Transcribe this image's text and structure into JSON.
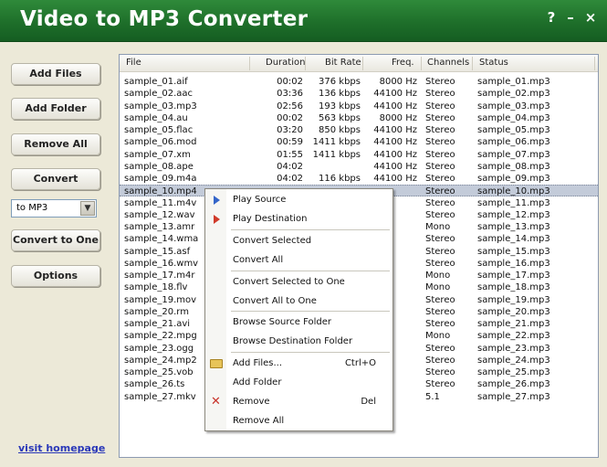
{
  "window": {
    "title": "Video to MP3 Converter",
    "help_glyph": "?",
    "minimize_glyph": "–",
    "close_glyph": "×"
  },
  "left_panel": {
    "add_files": "Add Files",
    "add_folder": "Add Folder",
    "remove_all": "Remove All",
    "convert": "Convert",
    "format_selected": "to MP3",
    "convert_to_one": "Convert to One",
    "options": "Options",
    "homepage_link": "visit homepage"
  },
  "table": {
    "headers": {
      "file": "File",
      "duration": "Duration",
      "bitrate": "Bit Rate",
      "freq": "Freq.",
      "channels": "Channels",
      "status": "Status"
    },
    "selected_index": 9,
    "rows": [
      {
        "file": "sample_01.aif",
        "duration": "00:02",
        "bitrate": "376 kbps",
        "freq": "8000 Hz",
        "channels": "Stereo",
        "status": "sample_01.mp3"
      },
      {
        "file": "sample_02.aac",
        "duration": "03:36",
        "bitrate": "136 kbps",
        "freq": "44100 Hz",
        "channels": "Stereo",
        "status": "sample_02.mp3"
      },
      {
        "file": "sample_03.mp3",
        "duration": "02:56",
        "bitrate": "193 kbps",
        "freq": "44100 Hz",
        "channels": "Stereo",
        "status": "sample_03.mp3"
      },
      {
        "file": "sample_04.au",
        "duration": "00:02",
        "bitrate": "563 kbps",
        "freq": "8000 Hz",
        "channels": "Stereo",
        "status": "sample_04.mp3"
      },
      {
        "file": "sample_05.flac",
        "duration": "03:20",
        "bitrate": "850 kbps",
        "freq": "44100 Hz",
        "channels": "Stereo",
        "status": "sample_05.mp3"
      },
      {
        "file": "sample_06.mod",
        "duration": "00:59",
        "bitrate": "1411 kbps",
        "freq": "44100 Hz",
        "channels": "Stereo",
        "status": "sample_06.mp3"
      },
      {
        "file": "sample_07.xm",
        "duration": "01:55",
        "bitrate": "1411 kbps",
        "freq": "44100 Hz",
        "channels": "Stereo",
        "status": "sample_07.mp3"
      },
      {
        "file": "sample_08.ape",
        "duration": "04:02",
        "bitrate": "",
        "freq": "44100 Hz",
        "channels": "Stereo",
        "status": "sample_08.mp3"
      },
      {
        "file": "sample_09.m4a",
        "duration": "04:02",
        "bitrate": "116 kbps",
        "freq": "44100 Hz",
        "channels": "Stereo",
        "status": "sample_09.mp3"
      },
      {
        "file": "sample_10.mp4",
        "duration": "",
        "bitrate": "",
        "freq": "",
        "channels": "Stereo",
        "status": "sample_10.mp3"
      },
      {
        "file": "sample_11.m4v",
        "duration": "",
        "bitrate": "",
        "freq": "",
        "channels": "Stereo",
        "status": "sample_11.mp3"
      },
      {
        "file": "sample_12.wav",
        "duration": "",
        "bitrate": "",
        "freq": "",
        "channels": "Stereo",
        "status": "sample_12.mp3"
      },
      {
        "file": "sample_13.amr",
        "duration": "",
        "bitrate": "",
        "freq": "",
        "channels": "Mono",
        "status": "sample_13.mp3"
      },
      {
        "file": "sample_14.wma",
        "duration": "",
        "bitrate": "",
        "freq": "",
        "channels": "Stereo",
        "status": "sample_14.mp3"
      },
      {
        "file": "sample_15.asf",
        "duration": "",
        "bitrate": "",
        "freq": "",
        "channels": "Stereo",
        "status": "sample_15.mp3"
      },
      {
        "file": "sample_16.wmv",
        "duration": "",
        "bitrate": "",
        "freq": "",
        "channels": "Stereo",
        "status": "sample_16.mp3"
      },
      {
        "file": "sample_17.m4r",
        "duration": "",
        "bitrate": "",
        "freq": "",
        "channels": "Mono",
        "status": "sample_17.mp3"
      },
      {
        "file": "sample_18.flv",
        "duration": "",
        "bitrate": "",
        "freq": "",
        "channels": "Mono",
        "status": "sample_18.mp3"
      },
      {
        "file": "sample_19.mov",
        "duration": "",
        "bitrate": "",
        "freq": "",
        "channels": "Stereo",
        "status": "sample_19.mp3"
      },
      {
        "file": "sample_20.rm",
        "duration": "",
        "bitrate": "",
        "freq": "",
        "channels": "Stereo",
        "status": "sample_20.mp3"
      },
      {
        "file": "sample_21.avi",
        "duration": "",
        "bitrate": "",
        "freq": "",
        "channels": "Stereo",
        "status": "sample_21.mp3"
      },
      {
        "file": "sample_22.mpg",
        "duration": "",
        "bitrate": "",
        "freq": "",
        "channels": "Mono",
        "status": "sample_22.mp3"
      },
      {
        "file": "sample_23.ogg",
        "duration": "",
        "bitrate": "",
        "freq": "",
        "channels": "Stereo",
        "status": "sample_23.mp3"
      },
      {
        "file": "sample_24.mp2",
        "duration": "",
        "bitrate": "",
        "freq": "",
        "channels": "Stereo",
        "status": "sample_24.mp3"
      },
      {
        "file": "sample_25.vob",
        "duration": "",
        "bitrate": "",
        "freq": "",
        "channels": "Stereo",
        "status": "sample_25.mp3"
      },
      {
        "file": "sample_26.ts",
        "duration": "",
        "bitrate": "",
        "freq": "",
        "channels": "Stereo",
        "status": "sample_26.mp3"
      },
      {
        "file": "sample_27.mkv",
        "duration": "",
        "bitrate": "",
        "freq": "",
        "channels": "5.1",
        "status": "sample_27.mp3"
      }
    ]
  },
  "context_menu": {
    "items": [
      {
        "label": "Play Source",
        "icon": "play-blue-icon",
        "shortcut": ""
      },
      {
        "label": "Play Destination",
        "icon": "play-red-icon",
        "shortcut": ""
      },
      {
        "label": "Convert Selected",
        "icon": "",
        "shortcut": ""
      },
      {
        "label": "Convert All",
        "icon": "",
        "shortcut": ""
      },
      {
        "label": "Convert Selected to One",
        "icon": "",
        "shortcut": ""
      },
      {
        "label": "Convert All to One",
        "icon": "",
        "shortcut": ""
      },
      {
        "label": "Browse Source Folder",
        "icon": "",
        "shortcut": ""
      },
      {
        "label": "Browse Destination Folder",
        "icon": "",
        "shortcut": ""
      },
      {
        "label": "Add Files...",
        "icon": "open-folder-icon",
        "shortcut": "Ctrl+O"
      },
      {
        "label": "Add Folder",
        "icon": "",
        "shortcut": ""
      },
      {
        "label": "Remove",
        "icon": "remove-x-icon",
        "shortcut": "Del"
      },
      {
        "label": "Remove All",
        "icon": "",
        "shortcut": ""
      }
    ]
  }
}
